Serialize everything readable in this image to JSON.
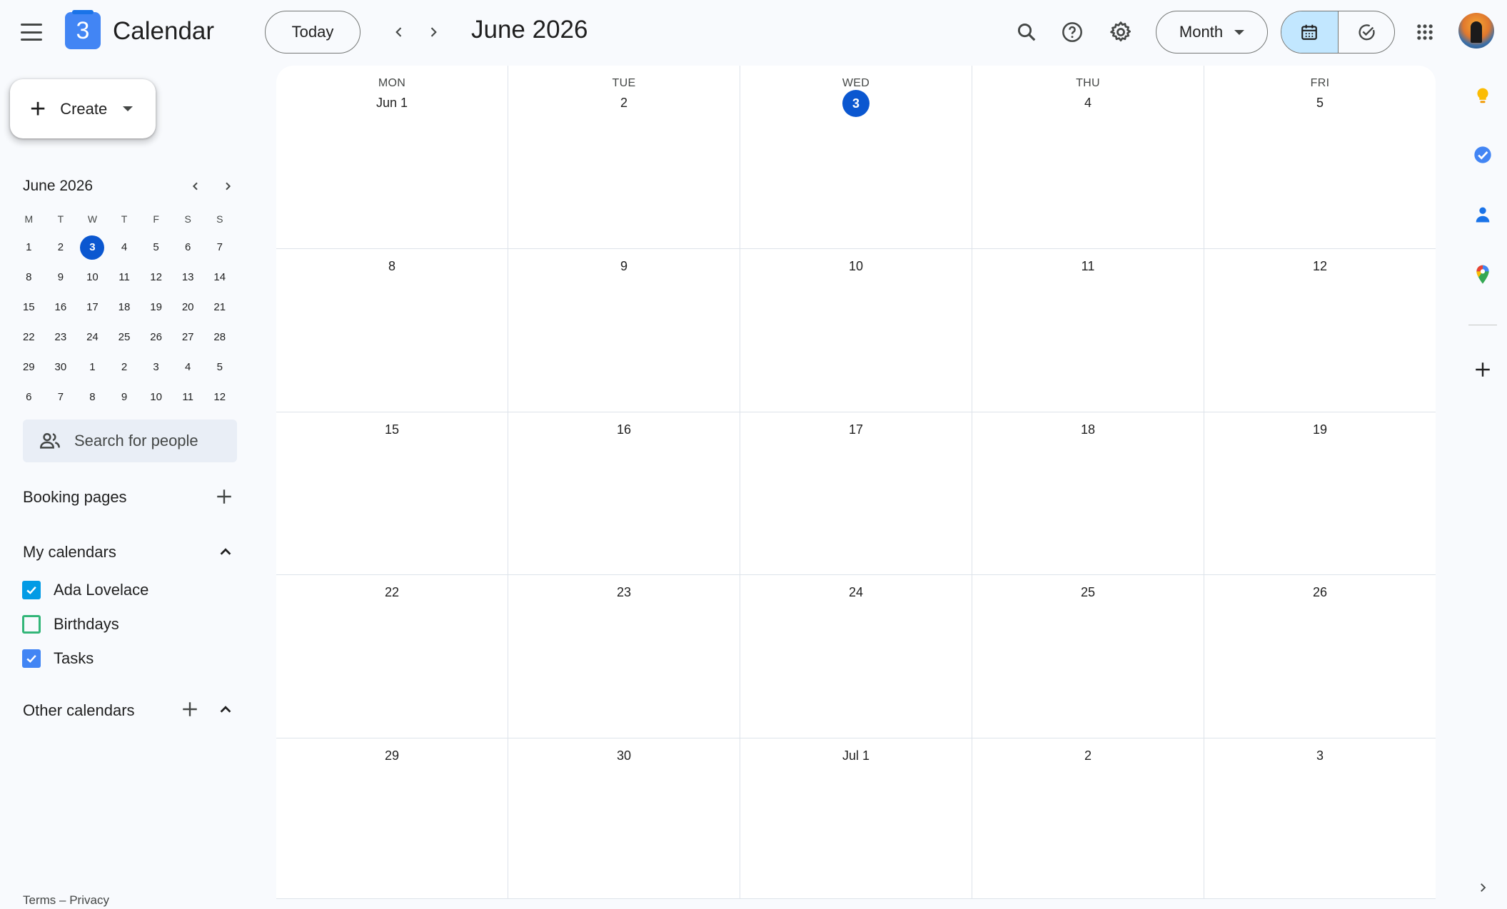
{
  "header": {
    "app_title": "Calendar",
    "logo_text": "3",
    "today_label": "Today",
    "period_title": "June 2026",
    "view_select": "Month",
    "icons": [
      "menu-icon",
      "search-icon",
      "help-icon",
      "settings-icon",
      "calendar-view-icon",
      "tasks-view-icon",
      "apps-grid-icon"
    ]
  },
  "sidebar": {
    "create_label": "Create",
    "mini_calendar": {
      "title": "June 2026",
      "weekdays": [
        "M",
        "T",
        "W",
        "T",
        "F",
        "S",
        "S"
      ],
      "weeks": [
        [
          "1",
          "2",
          "3",
          "4",
          "5",
          "6",
          "7"
        ],
        [
          "8",
          "9",
          "10",
          "11",
          "12",
          "13",
          "14"
        ],
        [
          "15",
          "16",
          "17",
          "18",
          "19",
          "20",
          "21"
        ],
        [
          "22",
          "23",
          "24",
          "25",
          "26",
          "27",
          "28"
        ],
        [
          "29",
          "30",
          "1",
          "2",
          "3",
          "4",
          "5"
        ],
        [
          "6",
          "7",
          "8",
          "9",
          "10",
          "11",
          "12"
        ]
      ],
      "selected": "3"
    },
    "search_placeholder": "Search for people",
    "booking_pages": "Booking pages",
    "my_calendars": {
      "title": "My calendars",
      "items": [
        {
          "label": "Ada Lovelace",
          "checked": true,
          "color": "#039be5"
        },
        {
          "label": "Birthdays",
          "checked": false,
          "color": "#33b679"
        },
        {
          "label": "Tasks",
          "checked": true,
          "color": "#4285f4"
        }
      ]
    },
    "other_calendars": "Other calendars",
    "footer": {
      "terms": "Terms",
      "sep": "–",
      "privacy": "Privacy"
    }
  },
  "grid": {
    "weekdays": [
      "MON",
      "TUE",
      "WED",
      "THU",
      "FRI"
    ],
    "weeks": [
      [
        "Jun 1",
        "2",
        "3",
        "4",
        "5"
      ],
      [
        "8",
        "9",
        "10",
        "11",
        "12"
      ],
      [
        "15",
        "16",
        "17",
        "18",
        "19"
      ],
      [
        "22",
        "23",
        "24",
        "25",
        "26"
      ],
      [
        "29",
        "30",
        "Jul 1",
        "2",
        "3"
      ]
    ],
    "today": "3"
  },
  "side_panel": {
    "icons": [
      "keep-icon",
      "tasks-icon",
      "contacts-icon",
      "maps-icon",
      "add-addon-icon",
      "expand-panel-icon"
    ]
  },
  "colors": {
    "accent": "#0b57d0",
    "selected_view": "#c2e7ff",
    "background": "#f8fafd"
  }
}
